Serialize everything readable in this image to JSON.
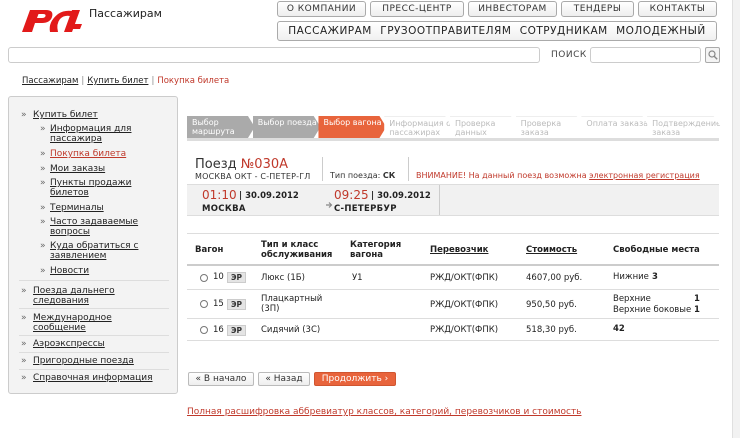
{
  "brand": {
    "logo_text": "Пассажирам",
    "color": "#e21a1a"
  },
  "top_menu": [
    "О КОМПАНИИ",
    "ПРЕСС-ЦЕНТР",
    "ИНВЕСТОРАМ",
    "ТЕНДЕРЫ",
    "КОНТАКТЫ"
  ],
  "main_menu": [
    "ПАССАЖИРАМ",
    "ГРУЗООТПРАВИТЕЛЯМ",
    "СОТРУДНИКАМ",
    "МОЛОДЕЖНЫЙ"
  ],
  "search": {
    "label": "ПОИСК",
    "value": ""
  },
  "breadcrumb": {
    "home": "Пассажирам",
    "parent": "Купить билет",
    "current": "Покупка билета"
  },
  "sidebar": {
    "buy": "Купить билет",
    "sub": [
      "Информация для пассажира",
      "Покупка билета",
      "Мои заказы",
      "Пункты продажи билетов",
      "Терминалы",
      "Часто задаваемые вопросы",
      "Куда обратиться с заявлением",
      "Новости"
    ],
    "sections": [
      "Поезда дальнего следования",
      "Международное сообщение",
      "Аэроэкспрессы",
      "Пригородные поезда",
      "Справочная информация"
    ]
  },
  "steps": [
    {
      "label": "Выбор маршрута",
      "state": "done"
    },
    {
      "label": "Выбор поезда",
      "state": "done"
    },
    {
      "label": "Выбор вагона",
      "state": "current"
    },
    {
      "label": "Информация о пассажирах",
      "state": "todo"
    },
    {
      "label": "Проверка данных",
      "state": "todo"
    },
    {
      "label": "Проверка заказа",
      "state": "todo"
    },
    {
      "label": "Оплата заказа",
      "state": "todo"
    },
    {
      "label": "Подтверждение заказа",
      "state": "todo"
    }
  ],
  "train": {
    "title_prefix": "Поезд",
    "number": "№030А",
    "route": "МОСКВА ОКТ - С-ПЕТЕР-ГЛ",
    "type_label": "Тип поезда:",
    "type_value": "СК",
    "warning_prefix": "ВНИМАНИЕ! На данный поезд возможна",
    "warning_link": "электронная регистрация"
  },
  "departure": {
    "time": "01:10",
    "date": "30.09.2012",
    "city": "МОСКВА"
  },
  "arrival": {
    "time": "09:25",
    "date": "30.09.2012",
    "city": "С-ПЕТЕРБУР"
  },
  "table": {
    "headers": {
      "car": "Вагон",
      "class": "Тип и класс обслуживания",
      "category": "Категория вагона",
      "carrier": "Перевозчик",
      "price": "Стоимость",
      "seats": "Свободные места"
    },
    "rows": [
      {
        "car": "10",
        "er": "ЭР",
        "class": "Люкс (1Б)",
        "category": "У1",
        "carrier": "РЖД/ОКТ(ФПК)",
        "price": "4607,00 руб.",
        "seats": [
          {
            "label": "Нижние",
            "count": "3"
          }
        ]
      },
      {
        "car": "15",
        "er": "ЭР",
        "class": "Плацкартный (3П)",
        "category": "",
        "carrier": "РЖД/ОКТ(ФПК)",
        "price": "950,50 руб.",
        "seats": [
          {
            "label": "Верхние",
            "count": "1"
          },
          {
            "label": "Верхние боковые",
            "count": "1"
          }
        ]
      },
      {
        "car": "16",
        "er": "ЭР",
        "class": "Сидячий (3С)",
        "category": "",
        "carrier": "РЖД/ОКТ(ФПК)",
        "price": "518,30 руб.",
        "seats": [
          {
            "label": "",
            "count": "42"
          }
        ]
      }
    ]
  },
  "buttons": {
    "start": "« В начало",
    "back": "« Назад",
    "continue": "Продолжить ›"
  },
  "footer_link": "Полная расшифровка аббревиатур классов, категорий, перевозчиков и стоимость",
  "colors": {
    "accent": "#e8643c",
    "link_red": "#c0392b",
    "step_done": "#aaaaaa"
  }
}
